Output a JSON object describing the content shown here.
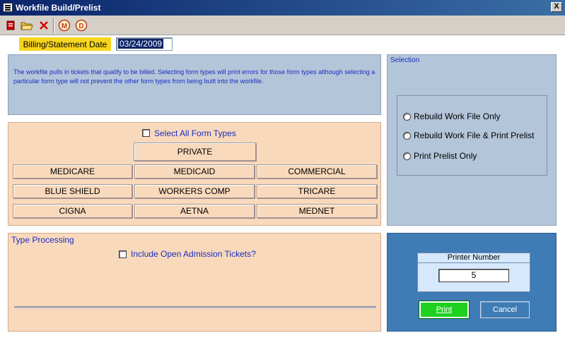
{
  "window": {
    "title": "Workfile Build/Prelist",
    "close_label": "X"
  },
  "toolbar": {
    "items": [
      {
        "icon": "stop-record-icon"
      },
      {
        "icon": "open-folder-icon"
      },
      {
        "icon": "delete-x-icon"
      },
      {
        "icon": "m-circle-icon",
        "glyph": "M"
      },
      {
        "icon": "d-circle-icon",
        "glyph": "D"
      }
    ]
  },
  "billing": {
    "label": "Billing/Statement Date",
    "value": "03/24/2009"
  },
  "info": {
    "text": "The workfile pulls in tickets that qualify to be billed. Selecting form types will print errors for those form types although selecting a particular form type will not prevent the other form types from being built into the workfile."
  },
  "forms": {
    "select_all_label": "Select All Form Types",
    "private": "PRIVATE",
    "buttons": [
      "MEDICARE",
      "MEDICAID",
      "COMMERCIAL",
      "BLUE SHIELD",
      "WORKERS COMP",
      "TRICARE",
      "CIGNA",
      "AETNA",
      "MEDNET"
    ]
  },
  "type_processing": {
    "title": "Type Processing",
    "include_label": "Include Open Admission Tickets?"
  },
  "selection": {
    "title": "Selection",
    "options": [
      "Rebuild Work File Only",
      "Rebuild Work File & Print Prelist",
      "Print Prelist Only"
    ]
  },
  "printer": {
    "title": "Printer Number",
    "value": "5",
    "print_label": "Print",
    "cancel_label": "Cancel"
  },
  "colors": {
    "title_bar": "#0a246a",
    "date_label_bg": "#f7d51d",
    "blue_panel": "#b3c5d9",
    "peach_panel": "#f9d9bc",
    "printer_panel": "#3f7bb5",
    "print_button": "#1fd11f",
    "caption_text": "#1a2dbf"
  }
}
